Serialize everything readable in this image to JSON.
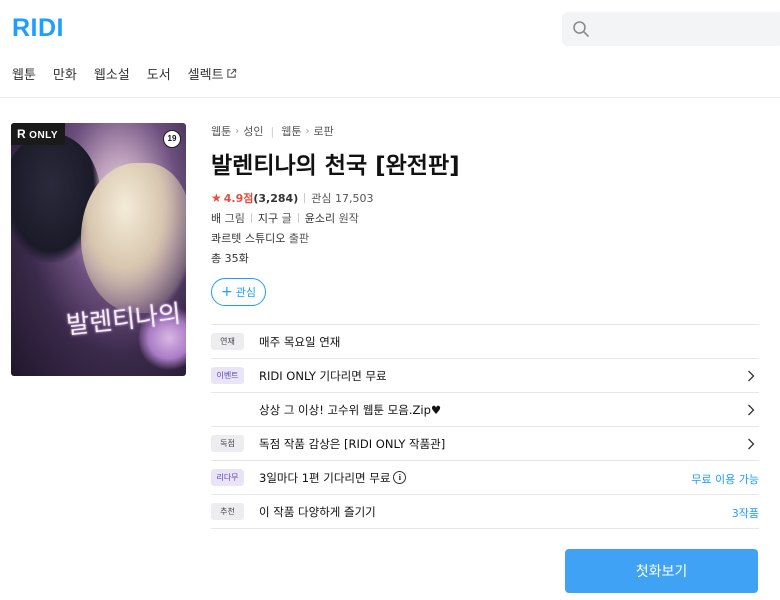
{
  "header": {
    "logo": "RIDI",
    "nav": [
      "웹툰",
      "만화",
      "웹소설",
      "도서",
      "셀렉트"
    ]
  },
  "cover": {
    "badge": "ONLY",
    "badge_letter": "R",
    "age": "19",
    "art_title": "발렌티나의 천국"
  },
  "work": {
    "breadcrumb": [
      "웹툰",
      "성인",
      "웹툰",
      "로판"
    ],
    "title": "발렌티나의 천국 [완전판]",
    "rating": "4.9점",
    "rating_count": "(3,284)",
    "interest_label": "관심",
    "interest_count": "17,503",
    "creators": [
      {
        "name": "배",
        "role": "그림"
      },
      {
        "name": "지구",
        "role": "글"
      },
      {
        "name": "윤소리",
        "role": "원작"
      }
    ],
    "publisher": "콰르텟 스튜디오",
    "publisher_role": "출판",
    "episodes": "총 35화",
    "follow_label": "관심"
  },
  "rows": [
    {
      "tag": "연재",
      "text": "매주 목요일 연재",
      "chevron": false,
      "right": ""
    },
    {
      "tag": "이벤트",
      "text": "RIDI ONLY 기다리면 무료",
      "chevron": true,
      "right": ""
    },
    {
      "tag": "",
      "text": "상상 그 이상! 고수위 웹툰 모음.Zip♥",
      "chevron": true,
      "right": ""
    },
    {
      "tag": "독점",
      "text": "독점 작품 감상은 [RIDI ONLY 작품관]",
      "chevron": true,
      "right": ""
    },
    {
      "tag": "리다무",
      "text": "3일마다 1편 기다리면 무료",
      "chevron": false,
      "right": "무료 이용 가능"
    },
    {
      "tag": "추천",
      "text": "이 작품 다양하게 즐기기",
      "chevron": false,
      "right": "3작품"
    }
  ],
  "read_button": "첫화보기",
  "colors": {
    "brand": "#1e9eff",
    "rating": "#e74c3c",
    "button": "#3fa2f5"
  }
}
